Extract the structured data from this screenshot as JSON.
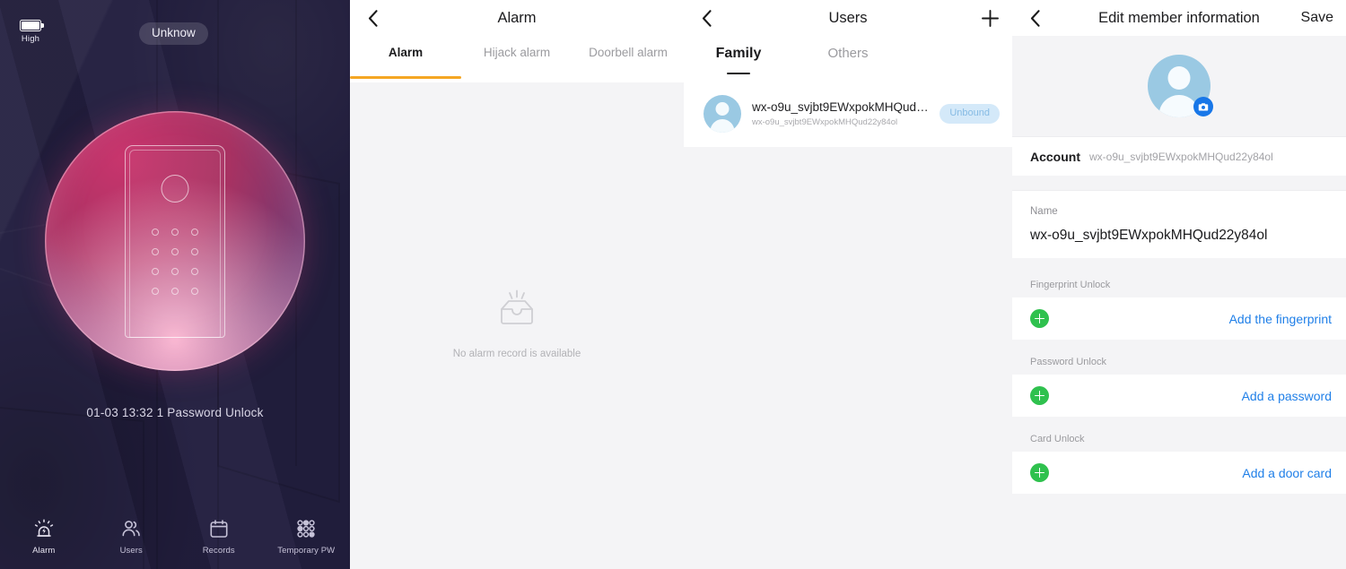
{
  "device": {
    "battery": {
      "icon": "battery-icon",
      "label": "High"
    },
    "status_pill": "Unknow",
    "lock_graphic": {
      "icon": "door-lock-keypad-icon",
      "keypad_rows": 4,
      "keypad_cols": 3
    },
    "last_event": "01-03 13:32  1 Password Unlock",
    "tabbar": [
      {
        "label": "Alarm",
        "icon": "siren-icon",
        "active": true
      },
      {
        "label": "Users",
        "icon": "people-icon",
        "active": false
      },
      {
        "label": "Records",
        "icon": "calendar-icon",
        "active": false
      },
      {
        "label": "Temporary PW",
        "icon": "keypad-dots-icon",
        "active": false
      }
    ]
  },
  "alarm": {
    "nav": {
      "back_icon": "chevron-left-icon",
      "title": "Alarm"
    },
    "tabs": [
      {
        "label": "Alarm",
        "selected": true
      },
      {
        "label": "Hijack alarm",
        "selected": false
      },
      {
        "label": "Doorbell alarm",
        "selected": false
      }
    ],
    "empty": {
      "icon": "empty-tray-icon",
      "text": "No alarm record is available"
    },
    "accent_color": "#f5a623"
  },
  "users": {
    "nav": {
      "back_icon": "chevron-left-icon",
      "title": "Users",
      "add_icon": "plus-icon"
    },
    "tabs": [
      {
        "label": "Family",
        "selected": true
      },
      {
        "label": "Others",
        "selected": false
      }
    ],
    "list": [
      {
        "name": "wx-o9u_svjbt9EWxpokMHQud22...",
        "sub": "wx-o9u_svjbt9EWxpokMHQud22y84ol",
        "badge": "Unbound",
        "avatar_icon": "person-avatar-icon"
      }
    ],
    "badge_bg": "#d4e9f9",
    "badge_fg": "#86bbe4"
  },
  "edit": {
    "nav": {
      "back_icon": "chevron-left-icon",
      "title": "Edit member information",
      "save_label": "Save"
    },
    "avatar": {
      "icon": "person-avatar-icon",
      "camera_icon": "camera-icon",
      "camera_color": "#1877e8"
    },
    "account": {
      "label": "Account",
      "value": "wx-o9u_svjbt9EWxpokMHQud22y84ol"
    },
    "name": {
      "label": "Name",
      "value": "wx-o9u_svjbt9EWxpokMHQud22y84ol"
    },
    "sections": [
      {
        "header": "Fingerprint Unlock",
        "add_icon": "plus-circle-icon",
        "link": "Add the fingerprint"
      },
      {
        "header": "Password Unlock",
        "add_icon": "plus-circle-icon",
        "link": "Add a password"
      },
      {
        "header": "Card Unlock",
        "add_icon": "plus-circle-icon",
        "link": "Add a door card"
      }
    ],
    "link_color": "#1f7fe8",
    "plus_color": "#2fc14e"
  }
}
